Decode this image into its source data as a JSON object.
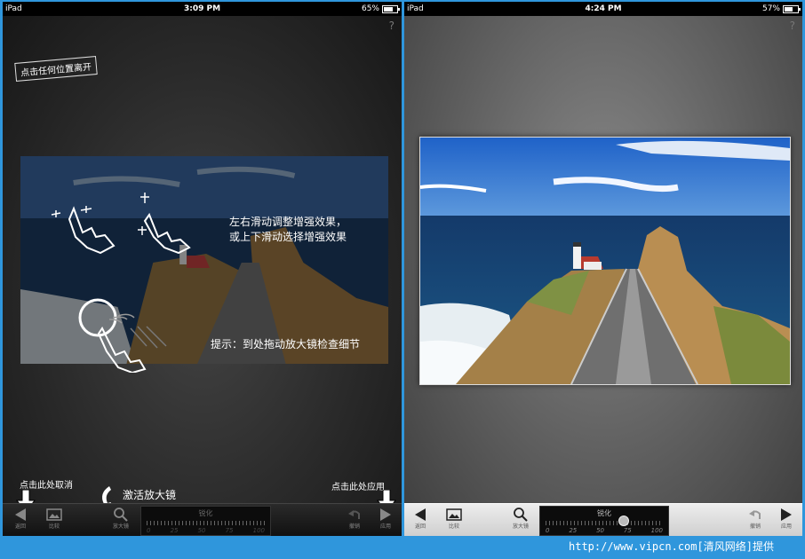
{
  "left_screen": {
    "status": {
      "carrier": "iPad",
      "time": "3:09 PM",
      "battery": "65%",
      "battery_level": 0.65
    },
    "help": "?",
    "overlay": {
      "leave_label": "点击任何位置离开",
      "swipe_hint_line1": "左右滑动调整增强效果，",
      "swipe_hint_line2": "或上下滑动选择增强效果",
      "loupe_hint": "提示：到处拖动放大镜检查细节",
      "cancel_hint": "点击此处取消",
      "loupe_activate_hint": "激活放大镜",
      "apply_hint": "点击此处应用"
    },
    "toolbar": {
      "back": "返回",
      "compare": "比较",
      "loupe": "放大镜",
      "slider_title": "锐化",
      "slider_ticks": [
        "0",
        "25",
        "50",
        "75",
        "100"
      ],
      "undo": "撤销",
      "apply": "应用"
    }
  },
  "right_screen": {
    "status": {
      "carrier": "iPad",
      "time": "4:24 PM",
      "battery": "57%",
      "battery_level": 0.57
    },
    "help": "?",
    "toolbar": {
      "back": "返回",
      "compare": "比较",
      "loupe": "放大镜",
      "slider_title": "锐化",
      "slider_ticks": [
        "0",
        "25",
        "50",
        "75",
        "100"
      ],
      "slider_value": 0.66,
      "undo": "撤销",
      "apply": "应用"
    }
  },
  "watermark": "http://www.vipcn.com[清风网络]提供",
  "icons": [
    "wifi-icon",
    "battery-icon",
    "back-arrow-icon",
    "image-icon",
    "magnifier-icon",
    "undo-icon",
    "forward-arrow-icon",
    "hand-icon"
  ]
}
